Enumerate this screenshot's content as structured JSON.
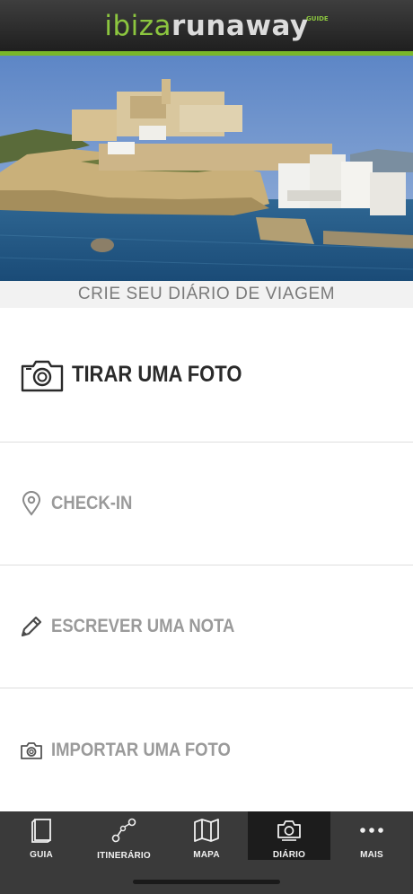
{
  "header": {
    "logo_part1": "ibiza",
    "logo_part2": "runaway",
    "logo_badge": "GUIDE",
    "brand_green": "#8cc63f"
  },
  "hero": {
    "icon": "ibiza-old-town-photo"
  },
  "subtitle": "CRIE SEU DIÁRIO DE VIAGEM",
  "actions": [
    {
      "label": "TIRAR UMA FOTO",
      "icon": "camera-icon"
    },
    {
      "label": "CHECK-IN",
      "icon": "location-pin-icon"
    },
    {
      "label": "ESCREVER UMA NOTA",
      "icon": "pencil-icon"
    },
    {
      "label": "IMPORTAR UMA FOTO",
      "icon": "camera-icon"
    }
  ],
  "tabs": [
    {
      "label": "GUIA",
      "icon": "book-icon",
      "active": false
    },
    {
      "label": "ITINERÁRIO",
      "icon": "route-icon",
      "active": false
    },
    {
      "label": "MAPA",
      "icon": "map-icon",
      "active": false
    },
    {
      "label": "DIÁRIO",
      "icon": "camera-icon",
      "active": true
    },
    {
      "label": "MAIS",
      "icon": "more-dots-icon",
      "active": false
    }
  ]
}
